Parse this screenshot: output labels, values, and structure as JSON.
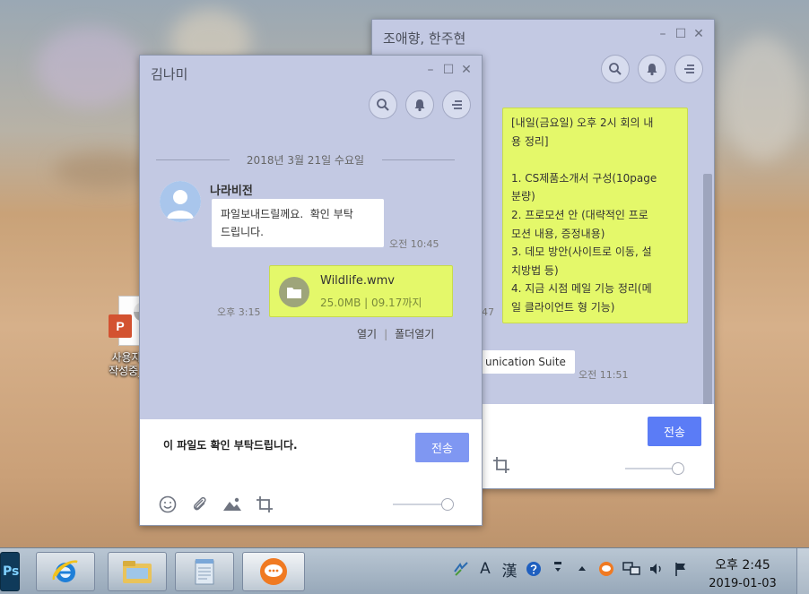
{
  "desktop": {
    "icon_label": "사용자 교육\n작성중_20..."
  },
  "back_window": {
    "title": "조애향, 한주현",
    "message": "[내일(금요일) 오후 2시 회의 내\n용 정리]\n\n1. CS제품소개서 구성(10page\n분량)\n2. 프로모션 안 (대략적인 프로\n모션 내용, 증정내용)\n3. 데모 방안(사이트로 이동, 설\n치방법 등)\n4. 지금 시점 메일 기능 정리(메\n일 클라이언트 형 기능)",
    "partial_time": "47",
    "partial_bubble": "unication Suite",
    "partial_bubble_time": "오전 11:51",
    "send_label": "전송",
    "accent": "#5b7cf6"
  },
  "front_window": {
    "title": "김나미",
    "date_separator": "2018년 3월 21일 수요일",
    "sender": "나라비전",
    "incoming_message": "파일보내드릴께요.  확인 부탁\n드립니다.",
    "incoming_time": "오전 10:45",
    "file_name": "Wildlife.wmv",
    "file_info": "25.0MB | 09.17까지",
    "file_time": "오후 3:15",
    "file_open": "열기",
    "file_separator": "|",
    "file_open_folder": "폴더열기",
    "input_text": "이 파일도 확인 부탁드립니다.",
    "send_label": "전송",
    "send_color": "#7f97f2"
  },
  "window_controls": {
    "minimize": "–",
    "maximize": "☐",
    "close": "✕"
  },
  "taskbar": {
    "ps_label": "Ps",
    "ime_a": "A",
    "ime_han": "漢",
    "clock_time": "오후 2:45",
    "clock_date": "2019-01-03"
  }
}
